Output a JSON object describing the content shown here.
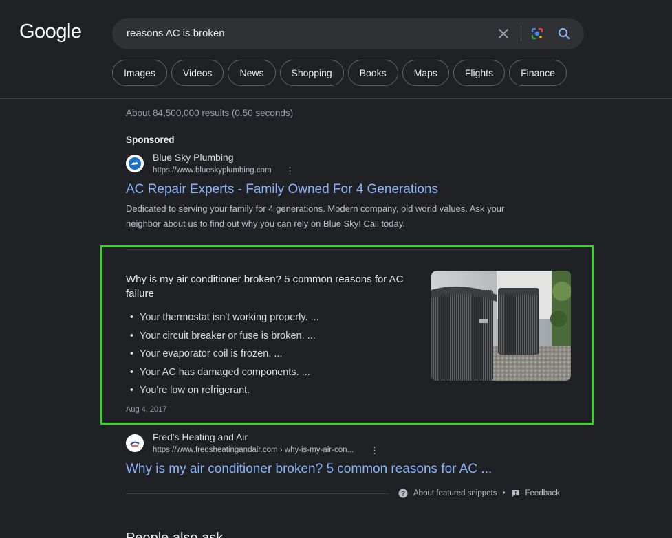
{
  "header": {
    "logo": "Google",
    "search_query": "reasons AC is broken"
  },
  "chips": [
    "Images",
    "Videos",
    "News",
    "Shopping",
    "Books",
    "Maps",
    "Flights",
    "Finance"
  ],
  "result_stats": "About 84,500,000 results (0.50 seconds)",
  "ad": {
    "label": "Sponsored",
    "site_name": "Blue Sky Plumbing",
    "url": "https://www.blueskyplumbing.com",
    "title": "AC Repair Experts - Family Owned For 4 Generations",
    "snippet": "Dedicated to serving your family for 4 generations. Modern company, old world values. Ask your neighbor about us to find out why you can rely on Blue Sky! Call today."
  },
  "featured_snippet": {
    "heading": "Why is my air conditioner broken? 5 common reasons for AC failure",
    "items": [
      "Your thermostat isn't working properly. ...",
      "Your circuit breaker or fuse is broken. ...",
      "Your evaporator coil is frozen. ...",
      "Your AC has damaged components. ...",
      "You're low on refrigerant."
    ],
    "date": "Aug 4, 2017",
    "highlight_color": "#3bd525"
  },
  "source": {
    "site_name": "Fred's Heating and Air",
    "url": "https://www.fredsheatingandair.com › why-is-my-air-con...",
    "title": "Why is my air conditioner broken? 5 common reasons for AC ..."
  },
  "footer": {
    "about_label": "About featured snippets",
    "separator": "•",
    "feedback_label": "Feedback"
  },
  "people_also_search": "People also ask"
}
